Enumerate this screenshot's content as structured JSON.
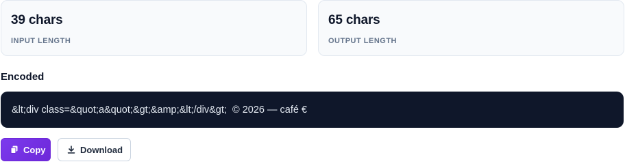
{
  "stats": {
    "input": {
      "value": "39 chars",
      "label": "INPUT LENGTH"
    },
    "output": {
      "value": "65 chars",
      "label": "OUTPUT LENGTH"
    }
  },
  "encoded": {
    "title": "Encoded",
    "value": "&lt;div class=&quot;a&quot;&gt;&amp;&lt;/div&gt;  © 2026 — café €"
  },
  "actions": {
    "copy_label": "Copy",
    "copy_icon": "copy-icon",
    "download_label": "Download",
    "download_icon": "download-icon"
  },
  "colors": {
    "accent": "#7c3aed",
    "output_bg": "#0f172a"
  }
}
